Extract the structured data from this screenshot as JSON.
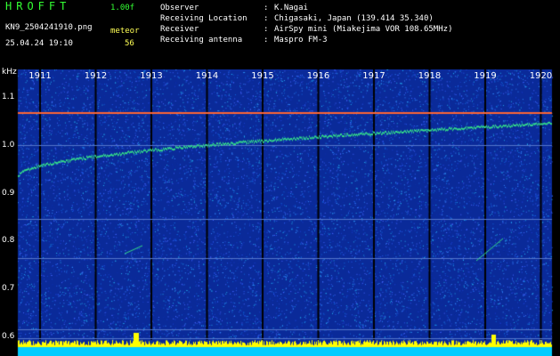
{
  "header": {
    "logo": "HROFFT",
    "version": "1.00f",
    "filename": "KN9_2504241910.png",
    "mode": "meteor",
    "datetime": "25.04.24 19:10",
    "count": "56"
  },
  "info": [
    {
      "key": "Observer",
      "value": "K.Nagai"
    },
    {
      "key": "Receiving Location",
      "value": "Chigasaki, Japan (139.414 35.340)"
    },
    {
      "key": "Receiver",
      "value": "AirSpy mini (Miakejima VOR 108.65MHz)"
    },
    {
      "key": "Receiving antenna",
      "value": "Maspro FM-3"
    }
  ],
  "colon": ":",
  "spectrogram": {
    "y_unit": "kHz",
    "y_ticks": [
      "1.1",
      "1.0",
      "0.9",
      "0.8",
      "0.7",
      "0.6"
    ],
    "y_range_khz": [
      0.56,
      1.16
    ],
    "x_ticks": [
      "1911",
      "1912",
      "1913",
      "1914",
      "1915",
      "1916",
      "1917",
      "1918",
      "1919",
      "1920"
    ],
    "x_range_min": [
      1910.6,
      1920.2
    ],
    "colors": {
      "background": "#0a2a99",
      "signal": "#33dd88",
      "carrier": "#ff6633",
      "bar": "#ffff00",
      "floor": "#00ccff"
    }
  }
}
